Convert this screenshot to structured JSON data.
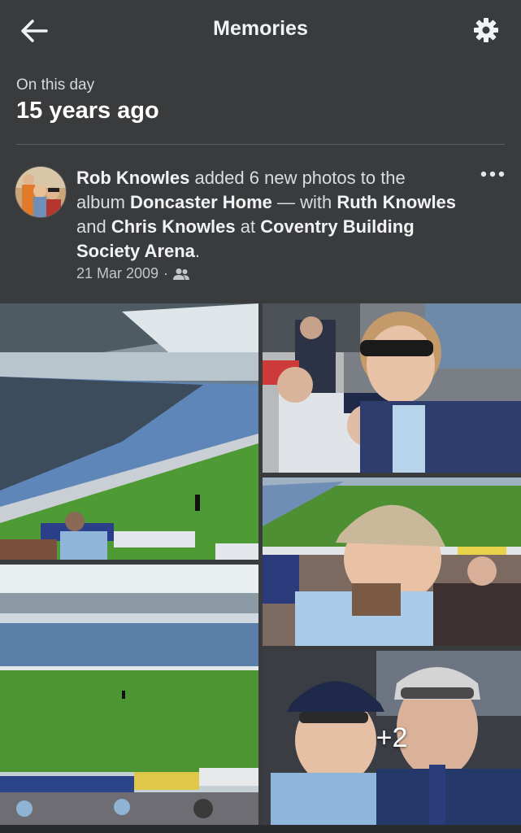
{
  "header": {
    "title": "Memories",
    "back_icon": "arrow-left-icon",
    "settings_icon": "gear-icon"
  },
  "section": {
    "subtitle": "On this day",
    "heading": "15 years ago"
  },
  "post": {
    "author": "Rob Knowles",
    "action": " added 6 new photos to the album ",
    "album": "Doncaster Home",
    "with_text": " — with ",
    "tag1": "Ruth Knowles",
    "and_text": " and ",
    "tag2": "Chris Knowles",
    "at_text": " at ",
    "place": "Coventry Building Society Arena",
    "end": ".",
    "date": "21 Mar 2009",
    "separator": "·",
    "privacy_icon": "friends-icon",
    "more_icon": "more-horizontal-icon"
  },
  "photos": {
    "extra_count": "+2"
  },
  "colors": {
    "background": "#3a3b3c",
    "text": "#e4e6eb",
    "pitch": "#4a8a2e",
    "sky_blue_kit": "#8ec3e8"
  }
}
